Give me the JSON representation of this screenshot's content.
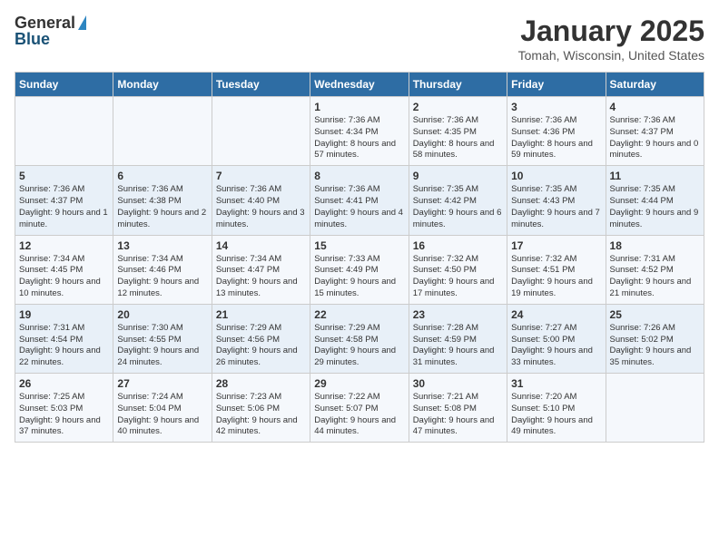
{
  "logo": {
    "general": "General",
    "blue": "Blue"
  },
  "title": "January 2025",
  "location": "Tomah, Wisconsin, United States",
  "days_of_week": [
    "Sunday",
    "Monday",
    "Tuesday",
    "Wednesday",
    "Thursday",
    "Friday",
    "Saturday"
  ],
  "weeks": [
    [
      {
        "day": "",
        "info": ""
      },
      {
        "day": "",
        "info": ""
      },
      {
        "day": "",
        "info": ""
      },
      {
        "day": "1",
        "info": "Sunrise: 7:36 AM\nSunset: 4:34 PM\nDaylight: 8 hours and 57 minutes."
      },
      {
        "day": "2",
        "info": "Sunrise: 7:36 AM\nSunset: 4:35 PM\nDaylight: 8 hours and 58 minutes."
      },
      {
        "day": "3",
        "info": "Sunrise: 7:36 AM\nSunset: 4:36 PM\nDaylight: 8 hours and 59 minutes."
      },
      {
        "day": "4",
        "info": "Sunrise: 7:36 AM\nSunset: 4:37 PM\nDaylight: 9 hours and 0 minutes."
      }
    ],
    [
      {
        "day": "5",
        "info": "Sunrise: 7:36 AM\nSunset: 4:37 PM\nDaylight: 9 hours and 1 minute."
      },
      {
        "day": "6",
        "info": "Sunrise: 7:36 AM\nSunset: 4:38 PM\nDaylight: 9 hours and 2 minutes."
      },
      {
        "day": "7",
        "info": "Sunrise: 7:36 AM\nSunset: 4:40 PM\nDaylight: 9 hours and 3 minutes."
      },
      {
        "day": "8",
        "info": "Sunrise: 7:36 AM\nSunset: 4:41 PM\nDaylight: 9 hours and 4 minutes."
      },
      {
        "day": "9",
        "info": "Sunrise: 7:35 AM\nSunset: 4:42 PM\nDaylight: 9 hours and 6 minutes."
      },
      {
        "day": "10",
        "info": "Sunrise: 7:35 AM\nSunset: 4:43 PM\nDaylight: 9 hours and 7 minutes."
      },
      {
        "day": "11",
        "info": "Sunrise: 7:35 AM\nSunset: 4:44 PM\nDaylight: 9 hours and 9 minutes."
      }
    ],
    [
      {
        "day": "12",
        "info": "Sunrise: 7:34 AM\nSunset: 4:45 PM\nDaylight: 9 hours and 10 minutes."
      },
      {
        "day": "13",
        "info": "Sunrise: 7:34 AM\nSunset: 4:46 PM\nDaylight: 9 hours and 12 minutes."
      },
      {
        "day": "14",
        "info": "Sunrise: 7:34 AM\nSunset: 4:47 PM\nDaylight: 9 hours and 13 minutes."
      },
      {
        "day": "15",
        "info": "Sunrise: 7:33 AM\nSunset: 4:49 PM\nDaylight: 9 hours and 15 minutes."
      },
      {
        "day": "16",
        "info": "Sunrise: 7:32 AM\nSunset: 4:50 PM\nDaylight: 9 hours and 17 minutes."
      },
      {
        "day": "17",
        "info": "Sunrise: 7:32 AM\nSunset: 4:51 PM\nDaylight: 9 hours and 19 minutes."
      },
      {
        "day": "18",
        "info": "Sunrise: 7:31 AM\nSunset: 4:52 PM\nDaylight: 9 hours and 21 minutes."
      }
    ],
    [
      {
        "day": "19",
        "info": "Sunrise: 7:31 AM\nSunset: 4:54 PM\nDaylight: 9 hours and 22 minutes."
      },
      {
        "day": "20",
        "info": "Sunrise: 7:30 AM\nSunset: 4:55 PM\nDaylight: 9 hours and 24 minutes."
      },
      {
        "day": "21",
        "info": "Sunrise: 7:29 AM\nSunset: 4:56 PM\nDaylight: 9 hours and 26 minutes."
      },
      {
        "day": "22",
        "info": "Sunrise: 7:29 AM\nSunset: 4:58 PM\nDaylight: 9 hours and 29 minutes."
      },
      {
        "day": "23",
        "info": "Sunrise: 7:28 AM\nSunset: 4:59 PM\nDaylight: 9 hours and 31 minutes."
      },
      {
        "day": "24",
        "info": "Sunrise: 7:27 AM\nSunset: 5:00 PM\nDaylight: 9 hours and 33 minutes."
      },
      {
        "day": "25",
        "info": "Sunrise: 7:26 AM\nSunset: 5:02 PM\nDaylight: 9 hours and 35 minutes."
      }
    ],
    [
      {
        "day": "26",
        "info": "Sunrise: 7:25 AM\nSunset: 5:03 PM\nDaylight: 9 hours and 37 minutes."
      },
      {
        "day": "27",
        "info": "Sunrise: 7:24 AM\nSunset: 5:04 PM\nDaylight: 9 hours and 40 minutes."
      },
      {
        "day": "28",
        "info": "Sunrise: 7:23 AM\nSunset: 5:06 PM\nDaylight: 9 hours and 42 minutes."
      },
      {
        "day": "29",
        "info": "Sunrise: 7:22 AM\nSunset: 5:07 PM\nDaylight: 9 hours and 44 minutes."
      },
      {
        "day": "30",
        "info": "Sunrise: 7:21 AM\nSunset: 5:08 PM\nDaylight: 9 hours and 47 minutes."
      },
      {
        "day": "31",
        "info": "Sunrise: 7:20 AM\nSunset: 5:10 PM\nDaylight: 9 hours and 49 minutes."
      },
      {
        "day": "",
        "info": ""
      }
    ]
  ]
}
